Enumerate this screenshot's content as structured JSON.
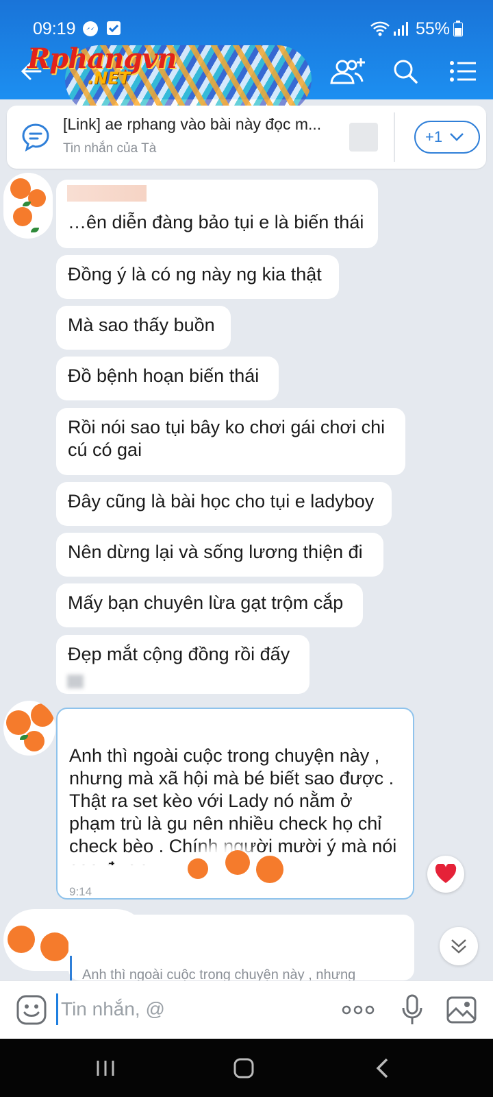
{
  "status_bar": {
    "time": "09:19",
    "battery": "55%"
  },
  "header": {
    "logo_text": "Rphangvn",
    "logo_sub": ".NET"
  },
  "pinned": {
    "title": "[Link] ae rphang vào bài này đọc m...",
    "subtitle": "Tin nhắn của Tà",
    "more_label": "+1"
  },
  "messages": [
    {
      "text": "…ên diễn đàng bảo tụi e là biến thái"
    },
    {
      "text": "Đồng ý là có ng này ng kia thật"
    },
    {
      "text": "Mà sao thấy buồn"
    },
    {
      "text": "Đồ bệnh hoạn biến thái"
    },
    {
      "text": "Rồi nói sao tụi bây ko chơi gái chơi chi cú có gai"
    },
    {
      "text": "Đây cũng là bài học cho tụi e ladyboy"
    },
    {
      "text": "Nên dừng lại và sống lương thiện đi"
    },
    {
      "text": "Mấy bạn chuyên lừa gạt trộm cắp"
    },
    {
      "text": "Đẹp mắt cộng đồng rồi đấy"
    }
  ],
  "quoted_message": {
    "text": "Anh thì ngoài cuộc trong chuyện này , nhưng mà xã hội mà bé biết sao được . Thật ra set kèo với Lady nó nằm ở phạm trù là gu nên nhiều check họ chỉ check bèo . Chính người mười ý mà nói sao được",
    "time": "9:14"
  },
  "reply_preview": "Anh thì ngoài cuộc trong chuyện này , nhưng",
  "composer": {
    "placeholder": "Tin nhắn, @"
  },
  "colors": {
    "header": "#1c8ff1",
    "accent": "#2f7fd8",
    "background": "#e5e9ef",
    "heart": "#e52238"
  }
}
